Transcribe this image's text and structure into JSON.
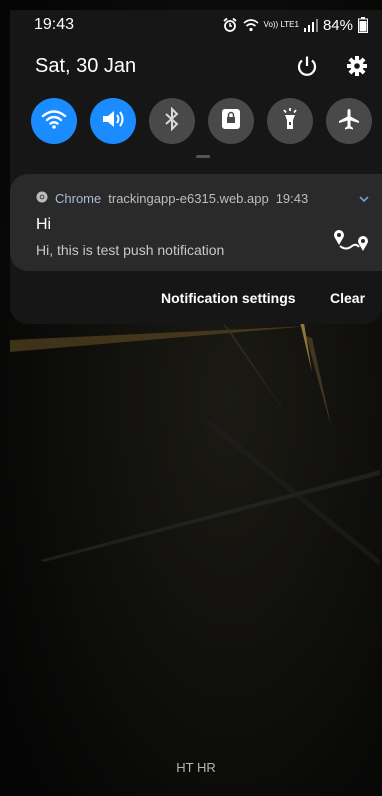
{
  "status_bar": {
    "time": "19:43",
    "network_label": "Vo)) LTE1",
    "battery": "84%"
  },
  "header": {
    "date": "Sat, 30 Jan"
  },
  "quick_settings": {
    "tiles": [
      {
        "icon": "wifi-icon",
        "state": "on"
      },
      {
        "icon": "sound-icon",
        "state": "on"
      },
      {
        "icon": "bluetooth-icon",
        "state": "off"
      },
      {
        "icon": "screen-lock-icon",
        "state": "off"
      },
      {
        "icon": "flashlight-icon",
        "state": "off"
      },
      {
        "icon": "airplane-icon",
        "state": "off"
      }
    ]
  },
  "notification": {
    "app": "Chrome",
    "source": "trackingapp-e6315.web.app",
    "time": "19:43",
    "title": "Hi",
    "text": "Hi, this is test push notification",
    "icon": "route-icon"
  },
  "actions": {
    "settings": "Notification settings",
    "clear": "Clear"
  },
  "carrier": "HT HR",
  "colors": {
    "accent": "#1a8cff",
    "panel": "#161616",
    "card": "#2a2a2a"
  }
}
